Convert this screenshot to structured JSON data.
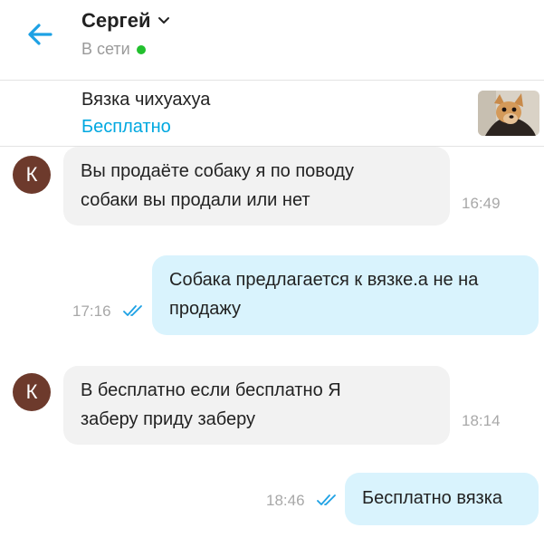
{
  "header": {
    "contact_name": "Сергей",
    "status": "В сети",
    "status_color": "#22c02e",
    "accent_color": "#00a8e0"
  },
  "listing": {
    "title": "Вязка чихуахуа",
    "price": "Бесплатно",
    "thumbnail_icon": "chihuahua-photo"
  },
  "messages": [
    {
      "direction": "incoming",
      "avatar_letter": "К",
      "lines": [
        "Вы продаёте собаку я по поводу",
        "собаки вы продали или нет"
      ],
      "time": "16:49"
    },
    {
      "direction": "outgoing",
      "lines": [
        "Собака предлагается к вязке.а не на",
        "продажу"
      ],
      "time": "17:16",
      "read": true
    },
    {
      "direction": "incoming",
      "avatar_letter": "К",
      "lines": [
        "В бесплатно если бесплатно Я",
        "заберу приду заберу"
      ],
      "time": "18:14"
    },
    {
      "direction": "outgoing",
      "lines": [
        "Бесплатно вязка"
      ],
      "time": "18:46",
      "read": true
    }
  ]
}
